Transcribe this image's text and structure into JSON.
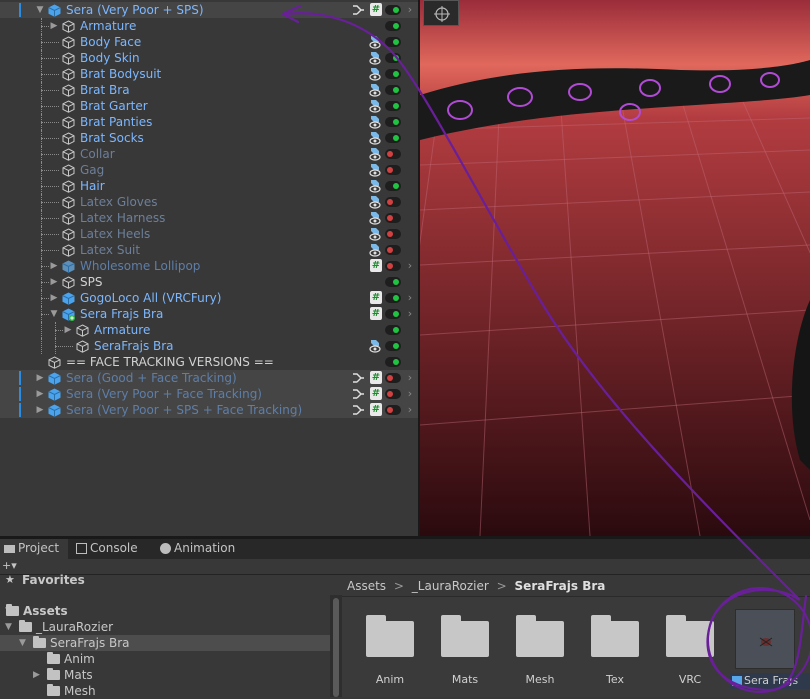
{
  "hierarchy": {
    "rows": [
      {
        "label": "Sera (Very Poor + SPS)",
        "color": "blue",
        "depth": 0,
        "arrow": "down",
        "icon": "prefab",
        "edge": true,
        "branch": true,
        "hash": true,
        "toggle": "on",
        "chev": true,
        "vis": false,
        "highlight": true
      },
      {
        "label": "Armature",
        "color": "blue",
        "depth": 1,
        "arrow": "right",
        "icon": "cube",
        "toggle": "on"
      },
      {
        "label": "Body Face",
        "color": "blue",
        "depth": 1,
        "icon": "cube",
        "vis": true,
        "toggle": "on"
      },
      {
        "label": "Body Skin",
        "color": "blue",
        "depth": 1,
        "icon": "cube",
        "vis": true,
        "toggle": "on"
      },
      {
        "label": "Brat Bodysuit",
        "color": "blue",
        "depth": 1,
        "icon": "cube",
        "vis": true,
        "toggle": "on"
      },
      {
        "label": "Brat Bra",
        "color": "blue",
        "depth": 1,
        "icon": "cube",
        "vis": true,
        "toggle": "on"
      },
      {
        "label": "Brat Garter",
        "color": "blue",
        "depth": 1,
        "icon": "cube",
        "vis": true,
        "toggle": "on"
      },
      {
        "label": "Brat Panties",
        "color": "blue",
        "depth": 1,
        "icon": "cube",
        "vis": true,
        "toggle": "on"
      },
      {
        "label": "Brat Socks",
        "color": "blue",
        "depth": 1,
        "icon": "cube",
        "vis": true,
        "toggle": "on"
      },
      {
        "label": "Collar",
        "color": "dim",
        "depth": 1,
        "icon": "cube",
        "vis": true,
        "toggle": "off"
      },
      {
        "label": "Gag",
        "color": "dim",
        "depth": 1,
        "icon": "cube",
        "vis": true,
        "toggle": "off"
      },
      {
        "label": "Hair",
        "color": "blue",
        "depth": 1,
        "icon": "cube",
        "vis": true,
        "toggle": "on"
      },
      {
        "label": "Latex Gloves",
        "color": "dim",
        "depth": 1,
        "icon": "cube",
        "vis": true,
        "toggle": "off"
      },
      {
        "label": "Latex Harness",
        "color": "dim",
        "depth": 1,
        "icon": "cube",
        "vis": true,
        "toggle": "off"
      },
      {
        "label": "Latex Heels",
        "color": "dim",
        "depth": 1,
        "icon": "cube",
        "vis": true,
        "toggle": "off"
      },
      {
        "label": "Latex Suit",
        "color": "dim",
        "depth": 1,
        "icon": "cube",
        "vis": true,
        "toggle": "off"
      },
      {
        "label": "Wholesome Lollipop",
        "color": "prefab-dim",
        "depth": 1,
        "arrow": "right",
        "icon": "prefab-striped",
        "hash": true,
        "toggle": "off",
        "chev": true
      },
      {
        "label": "SPS",
        "color": "white",
        "depth": 1,
        "arrow": "right",
        "icon": "cube",
        "toggle": "on"
      },
      {
        "label": "GogoLoco All (VRCFury)",
        "color": "blue",
        "depth": 1,
        "arrow": "right",
        "icon": "prefab",
        "hash": true,
        "toggle": "on",
        "chev": true
      },
      {
        "label": "Sera Frajs Bra",
        "color": "blue",
        "depth": 1,
        "arrow": "down",
        "icon": "prefab-plus",
        "hash": true,
        "toggle": "on",
        "chev": true
      },
      {
        "label": "Armature",
        "color": "blue",
        "depth": 2,
        "arrow": "right",
        "icon": "cube",
        "toggle": "on"
      },
      {
        "label": "SeraFrajs Bra",
        "color": "blue",
        "depth": 2,
        "icon": "cube",
        "vis": true,
        "toggle": "on"
      },
      {
        "label": "== FACE TRACKING VERSIONS ==",
        "color": "white",
        "depth": 0,
        "icon": "cube",
        "toggle": "on"
      },
      {
        "label": "Sera (Good + Face Tracking)",
        "color": "prefab-dim",
        "depth": 0,
        "arrow": "right",
        "icon": "prefab",
        "edge": true,
        "branch": true,
        "hash": true,
        "toggle": "off",
        "chev": true,
        "highlight": true
      },
      {
        "label": "Sera (Very Poor + Face Tracking)",
        "color": "prefab-dim",
        "depth": 0,
        "arrow": "right",
        "icon": "prefab",
        "edge": true,
        "branch": true,
        "hash": true,
        "toggle": "off",
        "chev": true,
        "highlight": true
      },
      {
        "label": "Sera (Very Poor + SPS + Face Tracking)",
        "color": "prefab-dim",
        "depth": 0,
        "arrow": "right",
        "icon": "prefab",
        "edge": true,
        "branch": true,
        "hash": true,
        "toggle": "off",
        "chev": true,
        "highlight": true
      }
    ]
  },
  "tabs": [
    {
      "label": "Project",
      "icon": "folder-icon",
      "active": true
    },
    {
      "label": "Console",
      "icon": "console-icon",
      "active": false
    },
    {
      "label": "Animation",
      "icon": "animation-icon",
      "active": false
    }
  ],
  "project_tree": {
    "favorites_label": "Favorites",
    "items": [
      {
        "label": "Assets",
        "depth": 0,
        "arrow": "down",
        "bold": true
      },
      {
        "label": "_LauraRozier",
        "depth": 1,
        "arrow": "down"
      },
      {
        "label": "SeraFrajs Bra",
        "depth": 2,
        "arrow": "down",
        "selected": true
      },
      {
        "label": "Anim",
        "depth": 3
      },
      {
        "label": "Mats",
        "depth": 3,
        "arrow": "right"
      },
      {
        "label": "Mesh",
        "depth": 3
      }
    ]
  },
  "breadcrumb": {
    "root": "Assets",
    "sep": ">",
    "mid": "_LauraRozier",
    "current": "SeraFrajs Bra"
  },
  "assets": [
    {
      "label": "Anim"
    },
    {
      "label": "Mats"
    },
    {
      "label": "Mesh"
    },
    {
      "label": "Tex"
    },
    {
      "label": "VRC"
    }
  ],
  "prefab_asset": {
    "label": "Sera Frajs"
  },
  "annotation_color": "#6a1f9a"
}
